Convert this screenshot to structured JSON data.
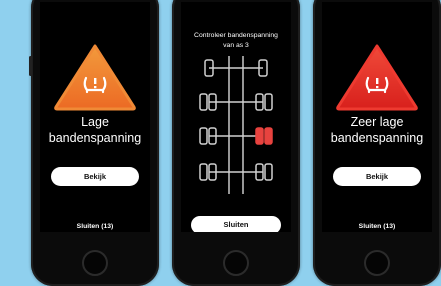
{
  "screens": [
    {
      "title_line1": "Lage",
      "title_line2": "bandenspanning",
      "view_button": "Bekijk",
      "close_label": "Sluiten (13)",
      "warning_color": "#f07a2a",
      "icon": "tire-pressure-warning-icon"
    },
    {
      "title_line1": "Controleer bandenspanning",
      "title_line2": "van as 3",
      "close_button": "Sluiten",
      "highlight_color": "#e8433f",
      "highlighted_axle": 3,
      "axle_count": 4,
      "icon": "axle-diagram-icon"
    },
    {
      "title_line1": "Zeer lage",
      "title_line2": "bandenspanning",
      "view_button": "Bekijk",
      "close_label": "Sluiten (13)",
      "warning_color": "#e8302a",
      "icon": "tire-pressure-warning-icon"
    }
  ],
  "background_color": "#8fd0ee"
}
